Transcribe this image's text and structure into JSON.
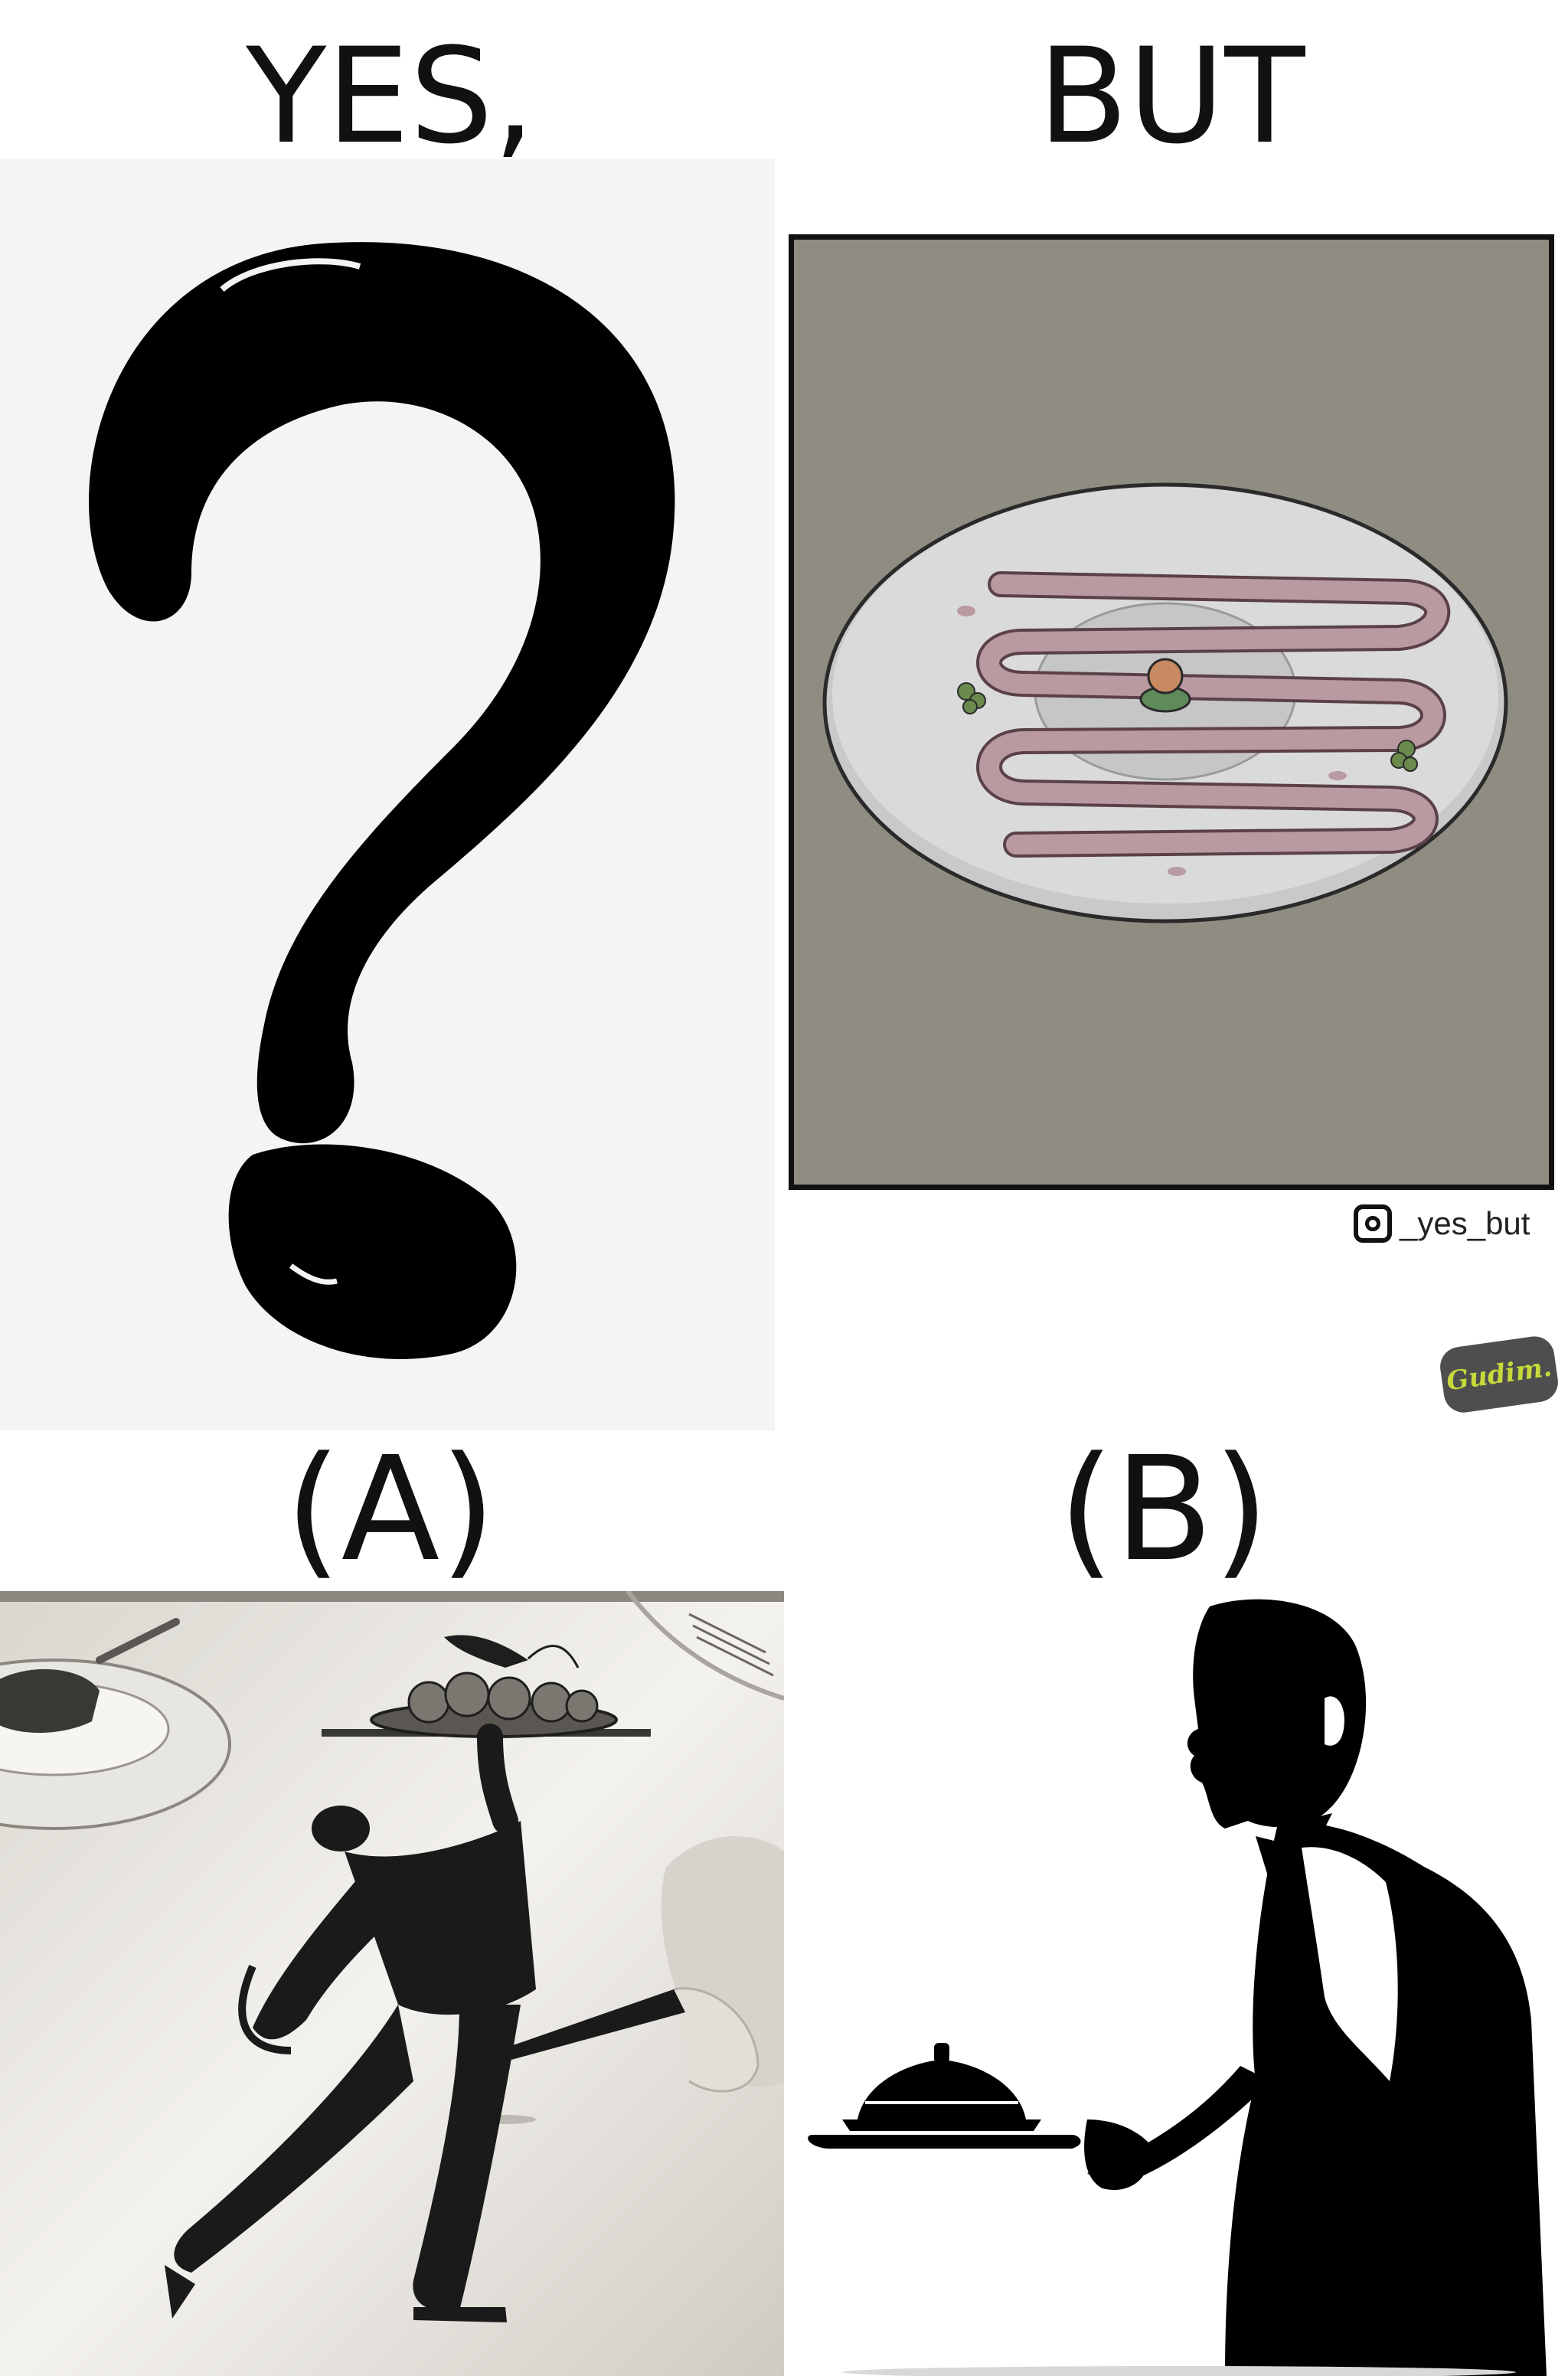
{
  "headings": {
    "left": "YES,",
    "right": "BUT"
  },
  "options": {
    "a": "(A)",
    "b": "(B)"
  },
  "credit": {
    "handle": "_yes_but",
    "icon": "instagram-icon"
  },
  "badge": {
    "text": "Gudim."
  }
}
